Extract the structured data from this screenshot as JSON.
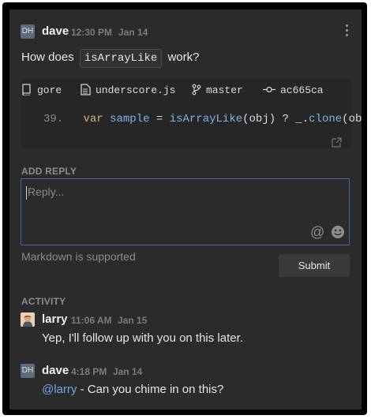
{
  "comment": {
    "avatar_initials": "DH",
    "author": "dave",
    "time": "12:30 PM",
    "date": "Jan 14",
    "question_prefix": "How does",
    "question_code": "isArrayLike",
    "question_suffix": "work?",
    "snippet": {
      "repo": "gore",
      "file": "underscore.js",
      "branch": "master",
      "commit": "ac665ca",
      "line_number": "39.",
      "code_tokens": {
        "kw": "var",
        "name": "sample",
        "eq": "=",
        "fn": "isArrayLike",
        "args": "(obj)",
        "rest": "? _.",
        "fn2": "clone",
        "args2": "(obj)"
      }
    }
  },
  "add_reply": {
    "title": "ADD REPLY",
    "placeholder": "Reply...",
    "markdown_note": "Markdown is supported",
    "submit_label": "Submit"
  },
  "activity": {
    "title": "ACTIVITY",
    "items": [
      {
        "author": "larry",
        "time": "11:06 AM",
        "date": "Jan 15",
        "text": "Yep, I'll follow up with you on this later."
      },
      {
        "avatar_initials": "DH",
        "author": "dave",
        "time": "4:18 PM",
        "date": "Jan 14",
        "mention": "@larry",
        "text": " - Can you chime in on this?"
      }
    ]
  },
  "colors": {
    "panel_bg": "#2b2b2b",
    "accent_border": "#3f6aa3",
    "mention": "#6fa9e6"
  },
  "icons": [
    "kebab-menu-icon",
    "repo-icon",
    "file-icon",
    "branch-icon",
    "commit-icon",
    "external-link-icon",
    "mention-icon",
    "emoji-icon",
    "larry-avatar"
  ]
}
